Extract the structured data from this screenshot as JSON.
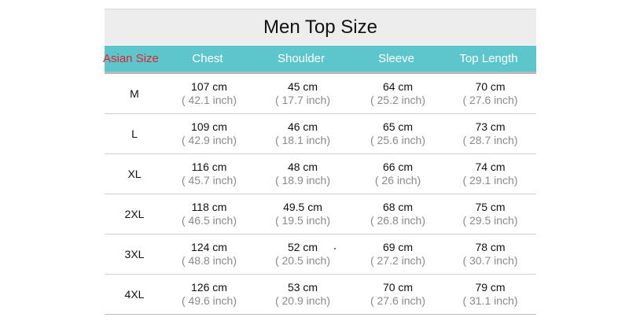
{
  "title": "Men Top Size",
  "header": {
    "size_label": "Asian Size",
    "columns": [
      "Chest",
      "Shoulder",
      "Sleeve",
      "Top Length"
    ]
  },
  "rows": [
    {
      "size": "M",
      "chest": [
        "107 cm",
        "( 42.1 inch)"
      ],
      "shoulder": [
        "45 cm",
        "( 17.7 inch)"
      ],
      "sleeve": [
        "64 cm",
        "( 25.2 inch)"
      ],
      "length": [
        "70 cm",
        "( 27.6 inch)"
      ]
    },
    {
      "size": "L",
      "chest": [
        "109 cm",
        "( 42.9 inch)"
      ],
      "shoulder": [
        "46 cm",
        "( 18.1 inch)"
      ],
      "sleeve": [
        "65 cm",
        "( 25.6 inch)"
      ],
      "length": [
        "73 cm",
        "( 28.7 inch)"
      ]
    },
    {
      "size": "XL",
      "chest": [
        "116 cm",
        "( 45.7 inch)"
      ],
      "shoulder": [
        "48 cm",
        "( 18.9 inch)"
      ],
      "sleeve": [
        "66 cm",
        "( 26 inch)"
      ],
      "length": [
        "74 cm",
        "( 29.1 inch)"
      ]
    },
    {
      "size": "2XL",
      "chest": [
        "118 cm",
        "( 46.5 inch)"
      ],
      "shoulder": [
        "49.5 cm",
        "( 19.5 inch)"
      ],
      "sleeve": [
        "68 cm",
        "( 26.8 inch)"
      ],
      "length": [
        "75 cm",
        "( 29.5 inch)"
      ]
    },
    {
      "size": "3XL",
      "chest": [
        "124 cm",
        "( 48.8 inch)"
      ],
      "shoulder": [
        "52 cm",
        "( 20.5 inch)"
      ],
      "sleeve": [
        "69 cm",
        "( 27.2 inch)"
      ],
      "length": [
        "78 cm",
        "( 30.7 inch)"
      ]
    },
    {
      "size": "4XL",
      "chest": [
        "126 cm",
        "( 49.6 inch)"
      ],
      "shoulder": [
        "53 cm",
        "( 20.9 inch)"
      ],
      "sleeve": [
        "70 cm",
        "( 27.6 inch)"
      ],
      "length": [
        "79 cm",
        "( 31.1 inch)"
      ]
    }
  ],
  "colors": {
    "header_bg": "#5cc6cc",
    "size_label": "#e3232a",
    "title_bg": "#ededed"
  }
}
